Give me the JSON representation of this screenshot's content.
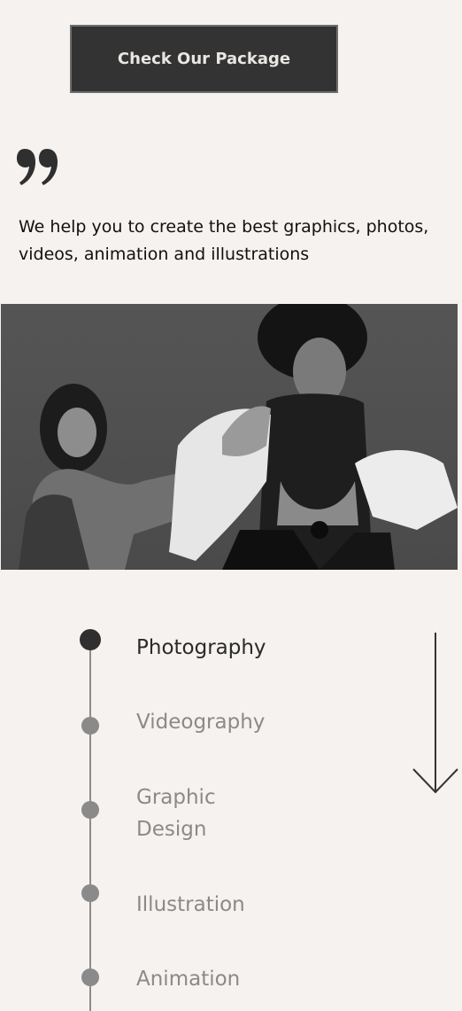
{
  "cta": {
    "label": "Check Our Package"
  },
  "quote": {
    "icon": "quote-icon",
    "text": "We help you to create the best graphics, photos, videos, animation and illustrations"
  },
  "hero": {
    "icon": "dancers-photo"
  },
  "services": {
    "active_index": 0,
    "items": [
      {
        "label": "Photography"
      },
      {
        "label": "Videography"
      },
      {
        "label": "Graphic Design"
      },
      {
        "label": "Illustration"
      },
      {
        "label": "Animation"
      }
    ]
  },
  "scroll_indicator": {
    "icon": "arrow-down-icon"
  },
  "colors": {
    "background": "#f5f2ef",
    "button": "#333333",
    "active": "#2f2f2f",
    "inactive": "#8a8a8a"
  }
}
